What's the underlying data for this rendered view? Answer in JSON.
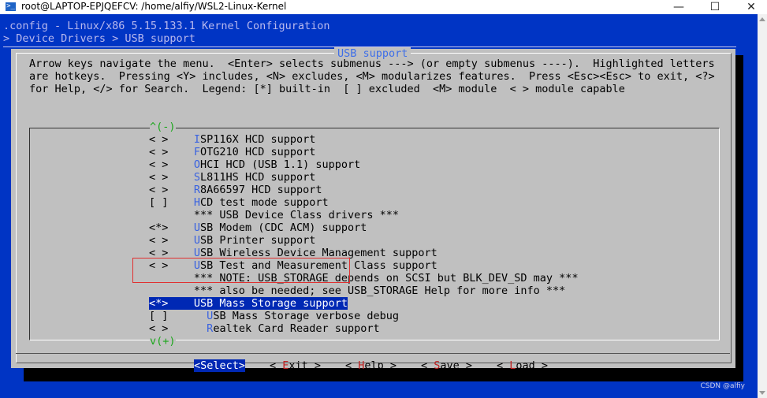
{
  "window": {
    "title": "root@LAPTOP-EPJQEFCV: /home/alfiy/WSL2-Linux-Kernel",
    "minimize": "—",
    "maximize": "☐",
    "close": "✕"
  },
  "terminal": {
    "header_line1": ".config - Linux/x86 5.15.133.1 Kernel Configuration",
    "header_line2": "> Device Drivers > USB support"
  },
  "dialog": {
    "title": "USB support",
    "help_lines": [
      "Arrow keys navigate the menu.  <Enter> selects submenus ---> (or empty submenus ----).  Highlighted letters",
      "are hotkeys.  Pressing <Y> includes, <N> excludes, <M> modularizes features.  Press <Esc><Esc> to exit, <?>",
      "for Help, </> for Search.  Legend: [*] built-in  [ ] excluded  <M> module  < > module capable"
    ],
    "scroll_up": "^(-)",
    "scroll_down": "v(+)"
  },
  "menu_items": [
    {
      "state": "< >",
      "hotkey": "I",
      "rest": "SP116X HCD support"
    },
    {
      "state": "< >",
      "hotkey": "F",
      "rest": "OTG210 HCD support"
    },
    {
      "state": "< >",
      "hotkey": "O",
      "rest": "HCI HCD (USB 1.1) support"
    },
    {
      "state": "< >",
      "hotkey": "S",
      "rest": "L811HS HCD support"
    },
    {
      "state": "< >",
      "hotkey": "R",
      "rest": "8A66597 HCD support"
    },
    {
      "state": "[ ]",
      "hotkey": "H",
      "rest": "CD test mode support"
    },
    {
      "state": "   ",
      "hotkey": "",
      "rest": "*** USB Device Class drivers ***"
    },
    {
      "state": "<*>",
      "hotkey": "U",
      "rest": "SB Modem (CDC ACM) support"
    },
    {
      "state": "< >",
      "hotkey": "U",
      "rest": "SB Printer support"
    },
    {
      "state": "< >",
      "hotkey": "U",
      "rest": "SB Wireless Device Management support"
    },
    {
      "state": "< >",
      "hotkey": "U",
      "rest": "SB Test and Measurement Class support"
    },
    {
      "state": "   ",
      "hotkey": "",
      "rest": "*** NOTE: USB_STORAGE depends on SCSI but BLK_DEV_SD may ***"
    },
    {
      "state": "   ",
      "hotkey": "",
      "rest": "*** also be needed; see USB_STORAGE Help for more info ***"
    },
    {
      "state": "<*>",
      "hotkey": "",
      "rest": "USB Mass Storage support",
      "selected": true
    },
    {
      "state": "[ ]",
      "hotkey": "U",
      "rest": "SB Mass Storage verbose debug",
      "indent": true
    },
    {
      "state": "< >",
      "hotkey": "R",
      "rest": "ealtek Card Reader support",
      "indent": true
    }
  ],
  "buttons": {
    "select": "<Select>",
    "exit": {
      "lead": "< ",
      "hotkey": "E",
      "rest": "xit >"
    },
    "help": {
      "lead": "< ",
      "hotkey": "H",
      "rest": "elp >"
    },
    "save": {
      "lead": "< ",
      "hotkey": "S",
      "rest": "ave >"
    },
    "load": {
      "lead": "< ",
      "hotkey": "L",
      "rest": "oad >"
    }
  },
  "watermark": "CSDN @alfiy"
}
